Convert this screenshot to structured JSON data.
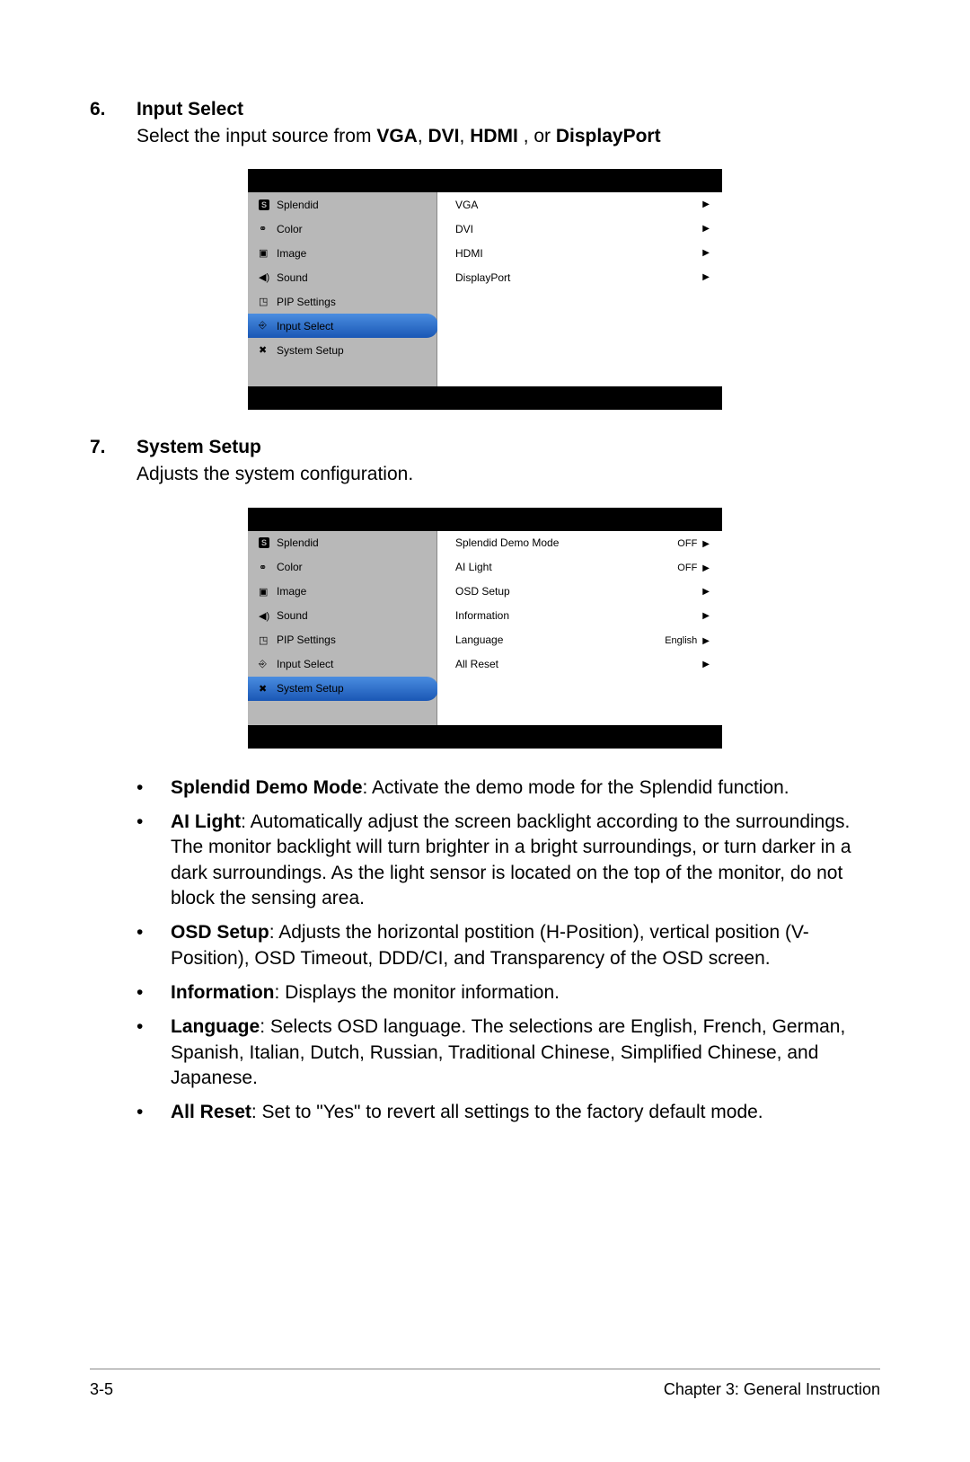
{
  "section6": {
    "num": "6.",
    "title": "Input Select",
    "desc_pre": "Select the input source from ",
    "b1": "VGA",
    "c1": ", ",
    "b2": "DVI",
    "c2": ", ",
    "b3": "HDMI",
    "c3": " , or ",
    "b4": "DisplayPort"
  },
  "osd1": {
    "left": [
      {
        "icon": "S",
        "label": "Splendid"
      },
      {
        "icon": "⚙",
        "label": "Color"
      },
      {
        "icon": "▣",
        "label": "Image"
      },
      {
        "icon": "🔊",
        "label": "Sound"
      },
      {
        "icon": "◳",
        "label": "PIP Settings"
      },
      {
        "icon": "⎆",
        "label": "Input Select"
      },
      {
        "icon": "✖",
        "label": "System Setup"
      }
    ],
    "active_index": 5,
    "right": [
      {
        "label": "VGA",
        "val": ""
      },
      {
        "label": "DVI",
        "val": ""
      },
      {
        "label": "HDMI",
        "val": ""
      },
      {
        "label": "DisplayPort",
        "val": ""
      }
    ]
  },
  "section7": {
    "num": "7.",
    "title": "System Setup",
    "desc": "Adjusts the system configuration."
  },
  "osd2": {
    "left": [
      {
        "icon": "S",
        "label": "Splendid"
      },
      {
        "icon": "⚙",
        "label": "Color"
      },
      {
        "icon": "▣",
        "label": "Image"
      },
      {
        "icon": "🔊",
        "label": "Sound"
      },
      {
        "icon": "◳",
        "label": "PIP Settings"
      },
      {
        "icon": "⎆",
        "label": "Input Select"
      },
      {
        "icon": "✖",
        "label": "System Setup"
      }
    ],
    "active_index": 6,
    "right": [
      {
        "label": "Splendid Demo Mode",
        "val": "OFF"
      },
      {
        "label": "AI Light",
        "val": "OFF"
      },
      {
        "label": "OSD Setup",
        "val": ""
      },
      {
        "label": "Information",
        "val": ""
      },
      {
        "label": "Language",
        "val": "English"
      },
      {
        "label": "All Reset",
        "val": ""
      }
    ]
  },
  "bullets": {
    "mark": "•",
    "i0b": "Splendid Demo Mode",
    "i0t": ": Activate the demo mode for the Splendid function.",
    "i1b": "AI Light",
    "i1t": ": Automatically adjust the screen backlight according to the surroundings. The monitor backlight will turn brighter in a bright surroundings, or turn darker in a dark surroundings. As the light sensor is located on the top of the monitor, do not block the sensing area.",
    "i2b": "OSD Setup",
    "i2t": ": Adjusts the horizontal postition (H-Position), vertical position (V-Position), OSD Timeout, DDD/CI, and Transparency of the OSD screen.",
    "i3b": "Information",
    "i3t": ": Displays the monitor information.",
    "i4b": "Language",
    "i4t": ": Selects OSD language. The selections are English, French, German, Spanish, Italian, Dutch, Russian, Traditional Chinese, Simplified Chinese, and Japanese.",
    "i5b": "All Reset",
    "i5t": ": Set to \"Yes\" to revert all settings to the factory default mode."
  },
  "footer": {
    "left": "3-5",
    "right": "Chapter 3: General Instruction"
  }
}
